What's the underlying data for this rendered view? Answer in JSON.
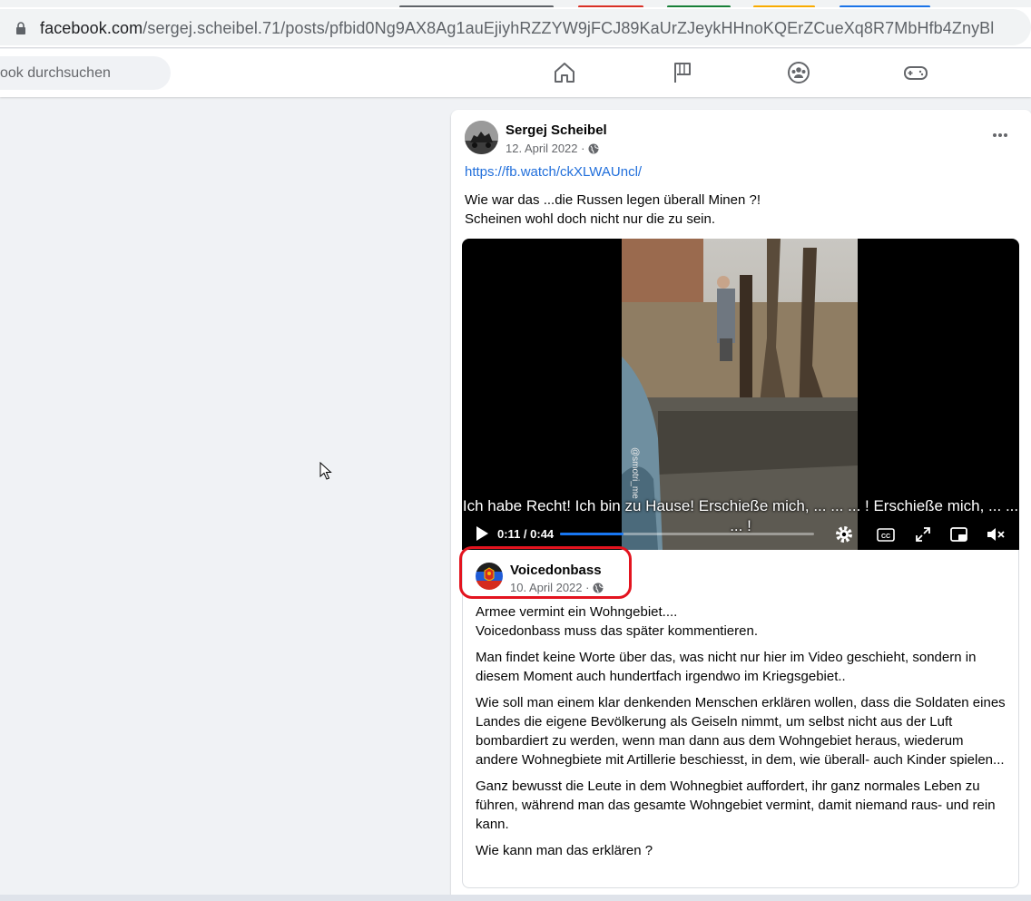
{
  "browser": {
    "url_domain": "facebook.com",
    "url_path": "/sergej.scheibel.71/posts/pfbid0Ng9AX8Ag1auEjiyhRZZYW9jFCJ89KaUrZJeykHHnoKQErZCueXq8R7MbHfb4ZnyBl",
    "tab_colors": [
      "#5f6368",
      "#d93025",
      "#188038",
      "#f9ab00",
      "#1a73e8"
    ]
  },
  "topbar": {
    "search_placeholder": "ook durchsuchen",
    "nav_icons": [
      "home-icon",
      "pages-flag-icon",
      "groups-icon",
      "gaming-icon"
    ]
  },
  "post": {
    "author": "Sergej Scheibel",
    "date": "12. April 2022 ·",
    "link": "https://fb.watch/ckXLWAUncl/",
    "text_lines": [
      "Wie war das ...die Russen legen überall Minen ?!",
      "Scheinen wohl doch nicht nur die zu sein."
    ]
  },
  "video": {
    "watermark": "@smotri_me",
    "subtitle": "Ich habe Recht! Ich bin zu Hause! Erschieße mich, ... ... ... ! Erschieße mich, ... ... ... !",
    "time": "0:11 / 0:44",
    "progress": 0.25,
    "accent": "#1877f2"
  },
  "shared_post": {
    "author": "Voicedonbass",
    "date": "10. April 2022 ·",
    "highlight_color": "#e3141f",
    "paragraphs": [
      "Armee vermint ein Wohngebiet....\nVoicedonbass muss das später kommentieren.",
      "Man findet  keine Worte über das, was nicht nur hier im Video geschieht, sondern in diesem Moment auch hundertfach irgendwo im Kriegsgebiet..",
      "Wie soll man einem klar denkenden Menschen erklären wollen,  dass die Soldaten eines Landes die eigene Bevölkerung als Geiseln nimmt, um selbst  nicht aus der Luft bombardiert zu werden, wenn man dann aus dem Wohngebiet heraus, wiederum andere Wohnegbiete mit Artillerie beschiesst, in dem, wie überall- auch Kinder spielen...",
      "Ganz bewusst die Leute in dem Wohnegbiet auffordert, ihr ganz normales Leben zu führen, während man das gesamte Wohngebiet vermint, damit niemand raus- und rein kann.",
      "Wie kann man das erklären ?"
    ]
  }
}
